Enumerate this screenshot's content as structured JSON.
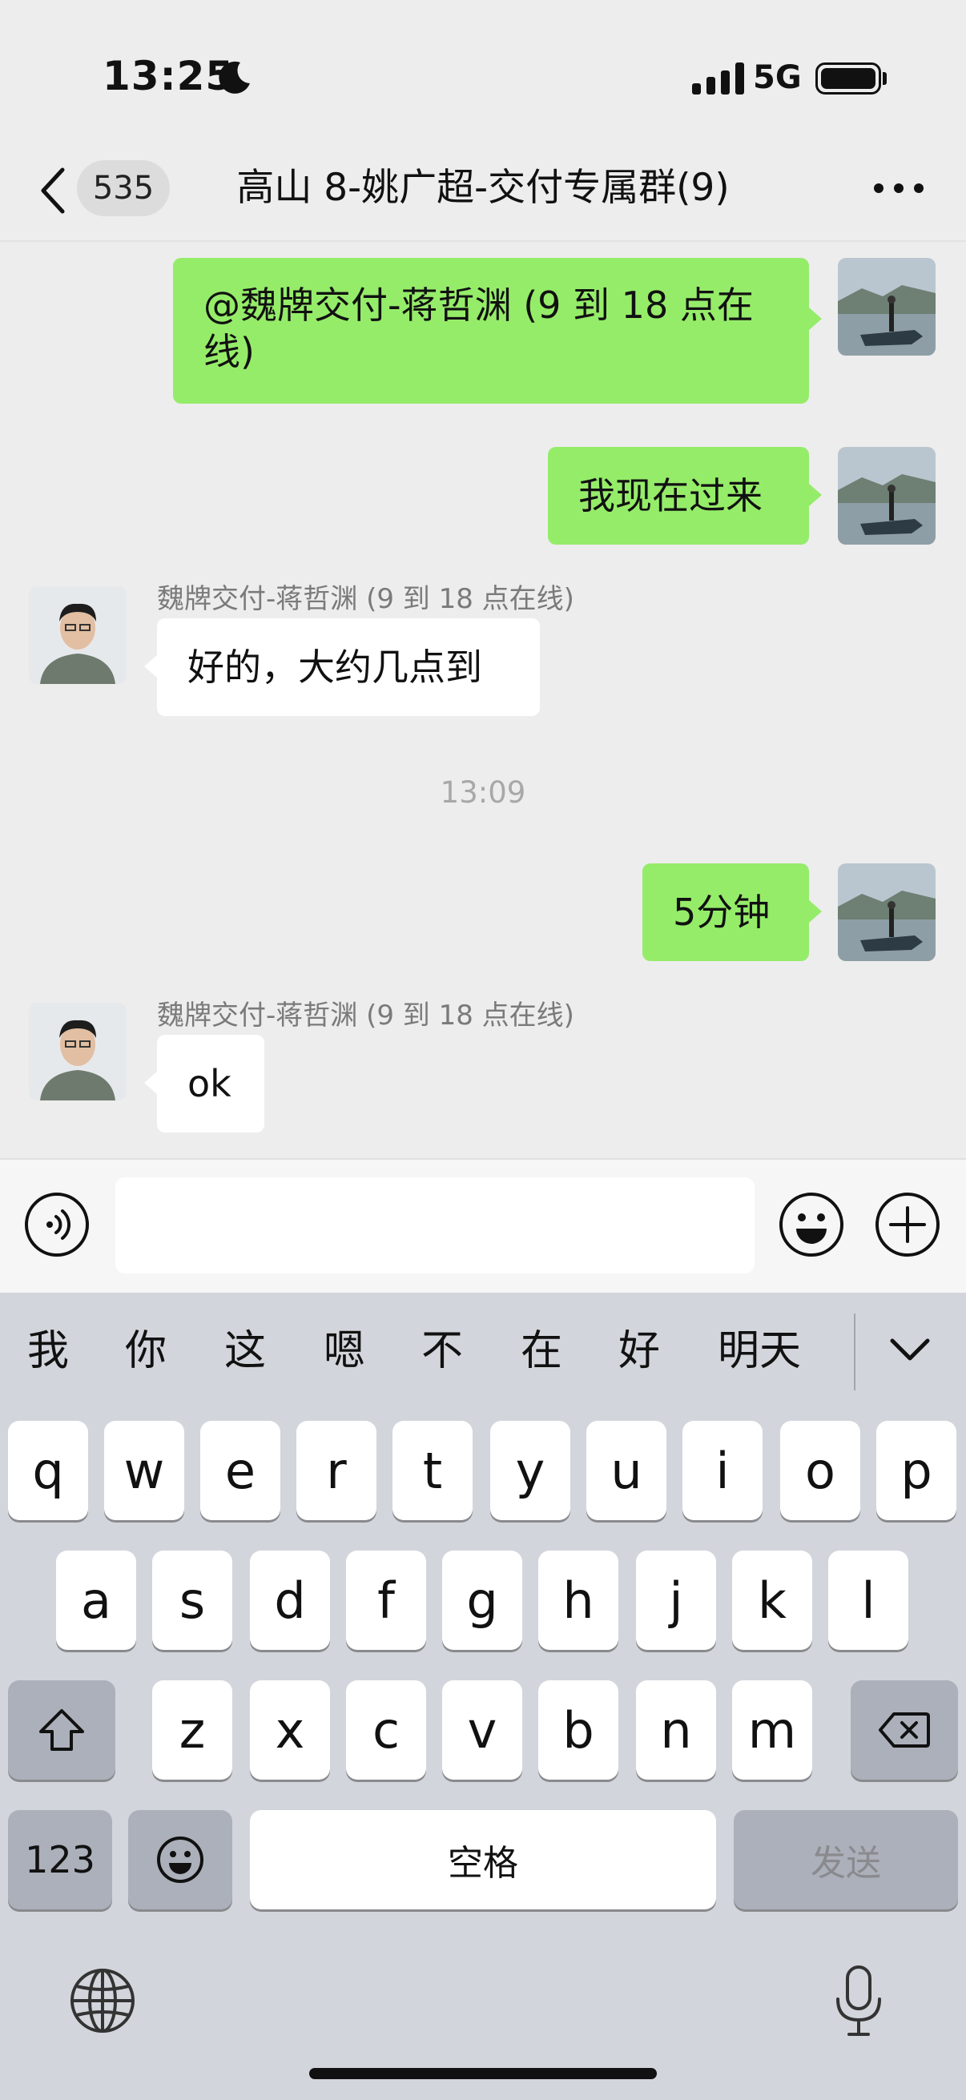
{
  "status_bar": {
    "time": "13:25",
    "network": "5G"
  },
  "nav": {
    "unread_count": "535",
    "title": "高山 8-姚广超-交付专属群(9)"
  },
  "messages": [
    {
      "from": "me",
      "text": "@魏牌交付-蒋哲渊 (9 到 18 点在线)"
    },
    {
      "from": "me",
      "text": "我现在过来"
    },
    {
      "from": "other",
      "sender": "魏牌交付-蒋哲渊 (9 到 18 点在线)",
      "text": "好的，大约几点到"
    },
    {
      "type": "timestamp",
      "text": "13:09"
    },
    {
      "from": "me",
      "text": "5分钟"
    },
    {
      "from": "other",
      "sender": "魏牌交付-蒋哲渊 (9 到 18 点在线)",
      "text": "ok"
    }
  ],
  "input": {
    "value": ""
  },
  "keyboard": {
    "suggestions": [
      "我",
      "你",
      "这",
      "嗯",
      "不",
      "在",
      "好",
      "明天"
    ],
    "row1": [
      "q",
      "w",
      "e",
      "r",
      "t",
      "y",
      "u",
      "i",
      "o",
      "p"
    ],
    "row2": [
      "a",
      "s",
      "d",
      "f",
      "g",
      "h",
      "j",
      "k",
      "l"
    ],
    "row3": [
      "z",
      "x",
      "c",
      "v",
      "b",
      "n",
      "m"
    ],
    "numbers_label": "123",
    "space_label": "空格",
    "send_label": "发送"
  },
  "colors": {
    "my_bubble": "#95ec69",
    "other_bubble": "#ffffff",
    "chat_bg": "#ededed",
    "keyboard_bg": "#d2d5db"
  },
  "icons": [
    "moon-icon",
    "signal-icon",
    "battery-icon",
    "back-chevron-icon",
    "more-icon",
    "voice-icon",
    "emoji-icon",
    "plus-icon",
    "collapse-keyboard-icon",
    "shift-icon",
    "backspace-icon",
    "emoji-key-icon",
    "globe-icon",
    "mic-icon"
  ]
}
